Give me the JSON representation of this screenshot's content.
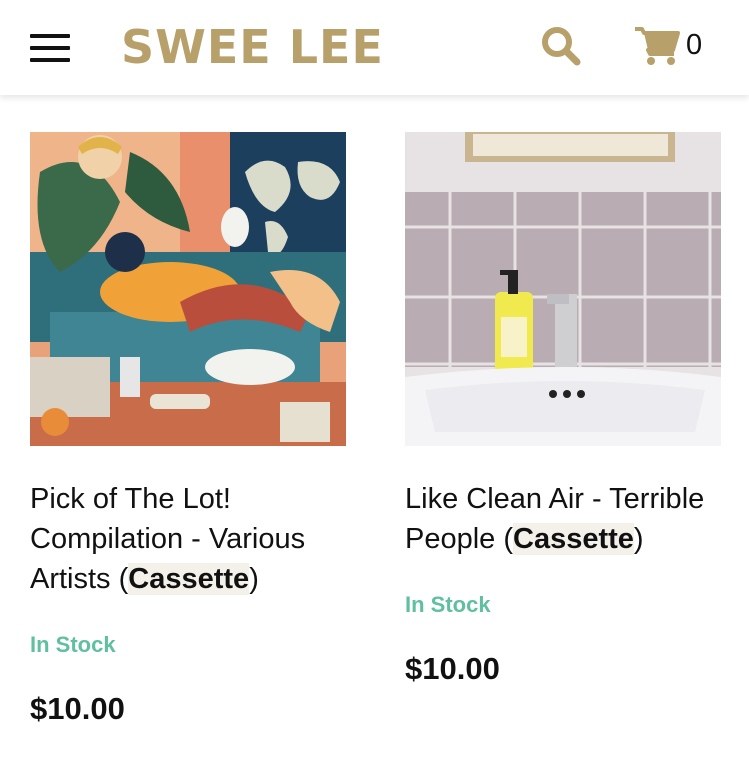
{
  "header": {
    "logo": "SWEE LEE",
    "cart_count": "0",
    "icons": {
      "menu": "hamburger-menu-icon",
      "search": "search-icon",
      "cart": "cart-icon"
    },
    "brand_color": "#b8a06a"
  },
  "products": [
    {
      "title": "Pick of The Lot! Compilation - Various Artists (",
      "format": "Cassette",
      "title_end": ")",
      "stock": "In Stock",
      "price": "$10.00"
    },
    {
      "title": "Like Clean Air - Terrible People (",
      "format": "Cassette",
      "title_end": ")",
      "stock": "In Stock",
      "price": "$10.00"
    }
  ],
  "colors": {
    "stock": "#5fbf9f",
    "text": "#111111"
  }
}
